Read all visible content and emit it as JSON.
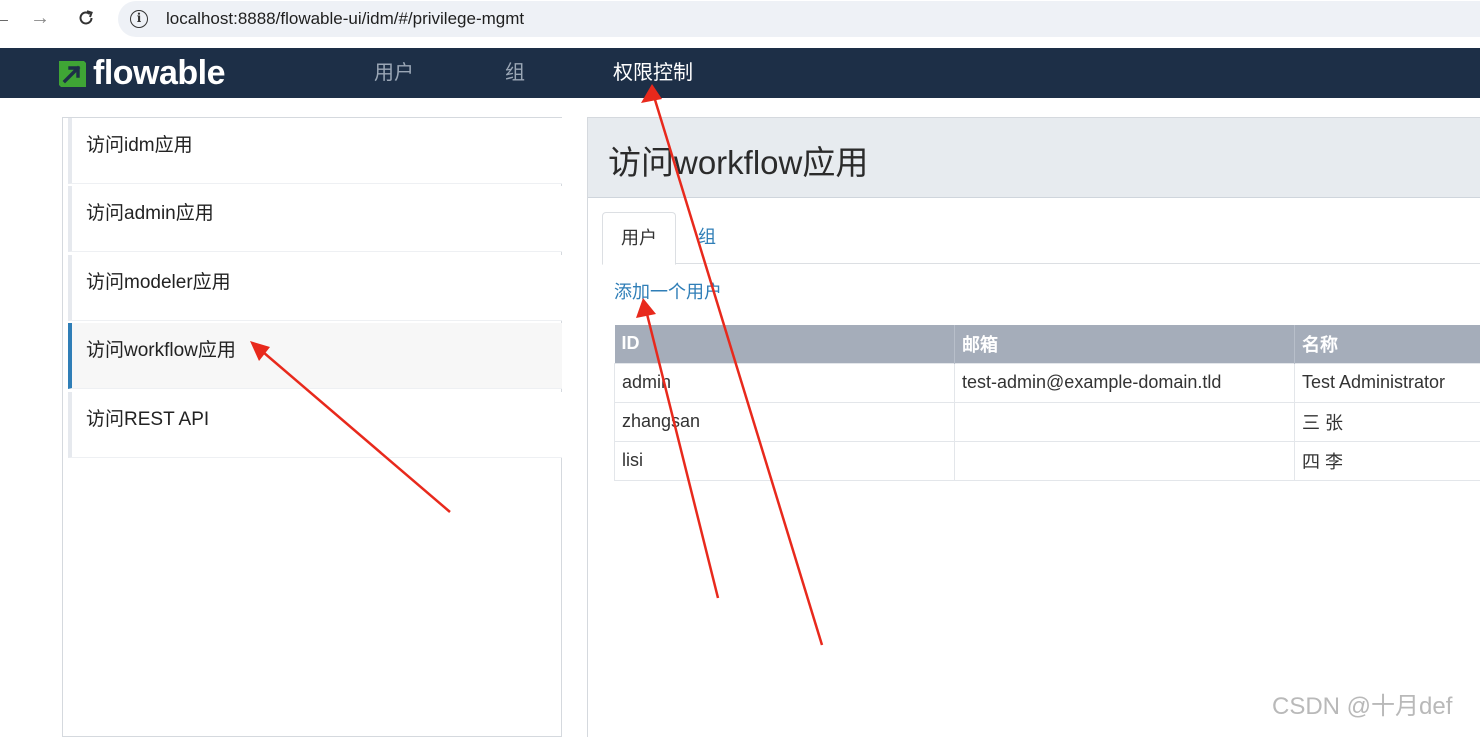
{
  "browser": {
    "url": "localhost:8888/flowable-ui/idm/#/privilege-mgmt"
  },
  "header": {
    "logo_text": "flowable",
    "nav": [
      {
        "label": "用户",
        "active": false
      },
      {
        "label": "组",
        "active": false
      },
      {
        "label": "权限控制",
        "active": true
      }
    ]
  },
  "sidebar": {
    "items": [
      {
        "label": "访问idm应用",
        "active": false
      },
      {
        "label": "访问admin应用",
        "active": false
      },
      {
        "label": "访问modeler应用",
        "active": false
      },
      {
        "label": "访问workflow应用",
        "active": true
      },
      {
        "label": "访问REST API",
        "active": false
      }
    ]
  },
  "main": {
    "title": "访问workflow应用",
    "tabs": [
      {
        "label": "用户",
        "active": true
      },
      {
        "label": "组",
        "active": false
      }
    ],
    "add_user_label": "添加一个用户",
    "table": {
      "columns": [
        "ID",
        "邮箱",
        "名称"
      ],
      "rows": [
        [
          "admin",
          "test-admin@example-domain.tld",
          "Test Administrator"
        ],
        [
          "zhangsan",
          "",
          "三 张"
        ],
        [
          "lisi",
          "",
          "四 李"
        ]
      ]
    }
  },
  "watermark": "CSDN @十月def",
  "colors": {
    "header_bg": "#1d2f47",
    "accent": "#2f7eb7",
    "logo_green": "#3fa535",
    "annotation_red": "#e8291c"
  }
}
